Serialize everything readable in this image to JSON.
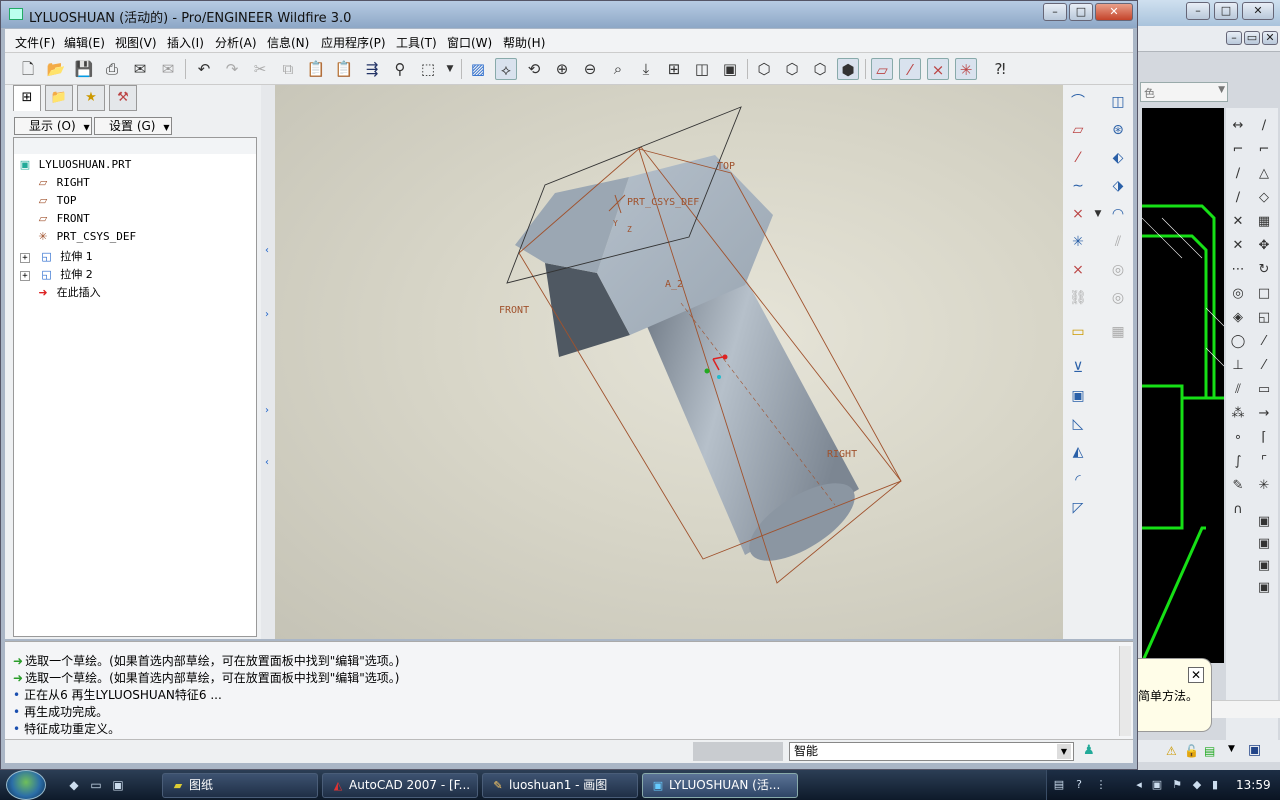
{
  "window": {
    "title": "LYLUOSHUAN (活动的) - Pro/ENGINEER Wildfire 3.0",
    "minimize": "▭",
    "maximize": "□",
    "close": "✕"
  },
  "menu": [
    "文件(F)",
    "编辑(E)",
    "视图(V)",
    "插入(I)",
    "分析(A)",
    "信息(N)",
    "应用程序(P)",
    "工具(T)",
    "窗口(W)",
    "帮助(H)"
  ],
  "nav": {
    "display_dropdown": "显示 (O)",
    "settings_dropdown": "设置 (G)",
    "tree": [
      {
        "label": "LYLUOSHUAN.PRT",
        "icon": "part-icon"
      },
      {
        "label": "RIGHT",
        "icon": "datum-plane-icon"
      },
      {
        "label": "TOP",
        "icon": "datum-plane-icon"
      },
      {
        "label": "FRONT",
        "icon": "datum-plane-icon"
      },
      {
        "label": "PRT_CSYS_DEF",
        "icon": "csys-icon"
      },
      {
        "label": "拉伸 1",
        "icon": "extrude-icon"
      },
      {
        "label": "拉伸 2",
        "icon": "extrude-icon"
      },
      {
        "label": "在此插入",
        "icon": "insert-here-arrow-icon"
      }
    ]
  },
  "viewport": {
    "labels": {
      "top": "TOP",
      "front": "FRONT",
      "right": "RIGHT",
      "csys": "PRT_CSYS_DEF",
      "axis": "A_2",
      "csys_y": "Y",
      "csys_z": "Z"
    },
    "colors": {
      "datum": "#a0522d",
      "body": "#8e9aa6"
    }
  },
  "messages": [
    {
      "type": "prompt",
      "text": "选取一个草绘。(如果首选内部草绘，可在放置面板中找到\"编辑\"选项。)"
    },
    {
      "type": "prompt",
      "text": "选取一个草绘。(如果首选内部草绘，可在放置面板中找到\"编辑\"选项。)"
    },
    {
      "type": "info",
      "text": "正在从6 再生LYLUOSHUAN特征6 ..."
    },
    {
      "type": "info",
      "text": "再生成功完成。"
    },
    {
      "type": "info",
      "text": "特征成功重定义。"
    }
  ],
  "status": {
    "filter": "智能"
  },
  "background_window": {
    "combo_text": "色",
    "balloon_text": "简单方法。",
    "balloon_close": "✕"
  },
  "taskbar": {
    "buttons": [
      {
        "label": "图纸",
        "icon": "folder-icon"
      },
      {
        "label": "AutoCAD 2007 - [F...",
        "icon": "autocad-icon"
      },
      {
        "label": "luoshuan1 - 画图",
        "icon": "paint-icon"
      },
      {
        "label": "LYLUOSHUAN (活...",
        "icon": "proe-icon"
      }
    ],
    "clock": "13:59"
  }
}
